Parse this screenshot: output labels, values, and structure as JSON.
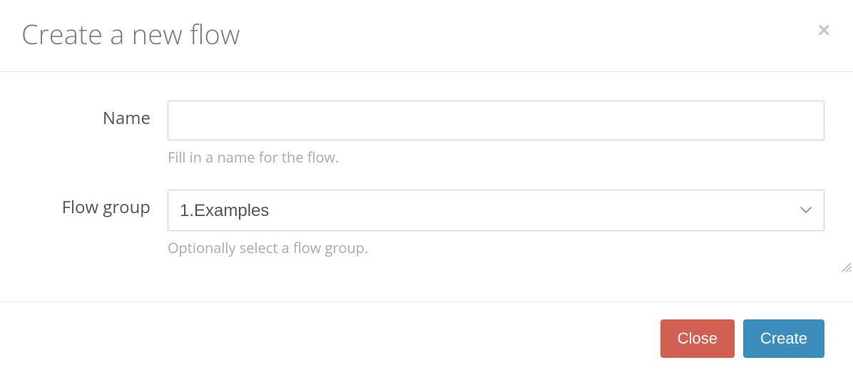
{
  "header": {
    "title": "Create a new flow"
  },
  "form": {
    "name": {
      "label": "Name",
      "value": "",
      "help": "Fill in a name for the flow."
    },
    "flow_group": {
      "label": "Flow group",
      "selected": "1.Examples",
      "help": "Optionally select a flow group."
    }
  },
  "footer": {
    "close_label": "Close",
    "create_label": "Create"
  }
}
